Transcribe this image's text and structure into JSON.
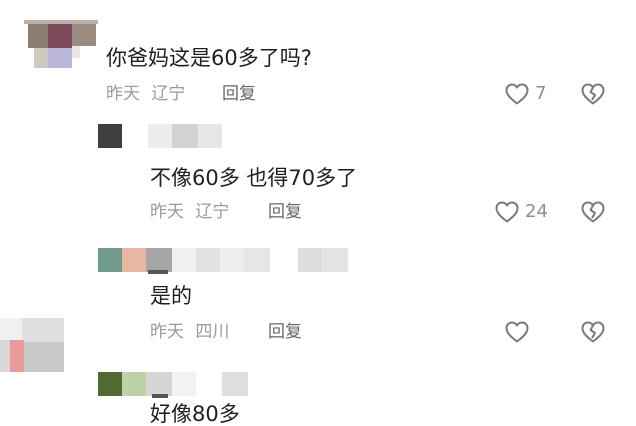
{
  "comments": [
    {
      "text": "你爸妈这是60多了吗?",
      "time": "昨天",
      "location": "辽宁",
      "reply_label": "回复",
      "like_count": "7",
      "like_icon": "heart-outline-icon",
      "dislike_icon": "broken-heart-icon"
    },
    {
      "text": "不像60多  也得70多了",
      "time": "昨天",
      "location": "辽宁",
      "reply_label": "回复",
      "like_count": "24",
      "like_icon": "heart-outline-icon",
      "dislike_icon": "broken-heart-icon"
    },
    {
      "text": "是的",
      "time": "昨天",
      "location": "四川",
      "reply_label": "回复",
      "like_count": "",
      "like_icon": "heart-outline-icon",
      "dislike_icon": "broken-heart-icon"
    },
    {
      "text": "好像80多"
    }
  ],
  "colors": {
    "text": "#1f1f1f",
    "meta": "#9b9b9b",
    "icon": "#7a7a7a",
    "mosaic": "#dcdcdc"
  }
}
